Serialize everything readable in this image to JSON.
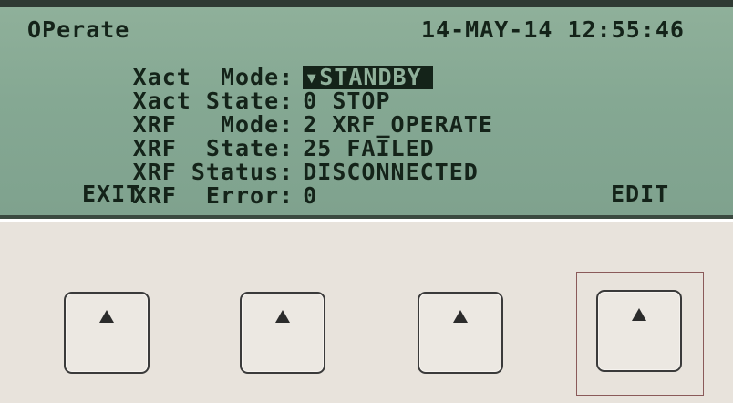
{
  "header": {
    "title": "OPerate",
    "datetime": "14-MAY-14 12:55:46"
  },
  "fields": [
    {
      "label": "Xact  Mode:",
      "value": "▾STANDBY",
      "highlighted": true
    },
    {
      "label": "Xact State:",
      "value": "0 STOP"
    },
    {
      "label": "XRF   Mode:",
      "value": "2 XRF_OPERATE"
    },
    {
      "label": "XRF  State:",
      "value": "25 FAILED"
    },
    {
      "label": "XRF Status:",
      "value": "DISCONNECTED"
    },
    {
      "label": "XRF  Error:",
      "value": "0"
    }
  ],
  "softkey_labels": {
    "left": "EXIT",
    "right": "EDIT"
  },
  "softkeys": [
    {
      "icon": "up-arrow-icon"
    },
    {
      "icon": "up-arrow-icon"
    },
    {
      "icon": "up-arrow-icon"
    },
    {
      "icon": "up-arrow-icon",
      "selected": true
    }
  ],
  "colors": {
    "lcd_background": "#8fb09a",
    "lcd_text": "#142319",
    "panel": "#e8e3dc"
  }
}
